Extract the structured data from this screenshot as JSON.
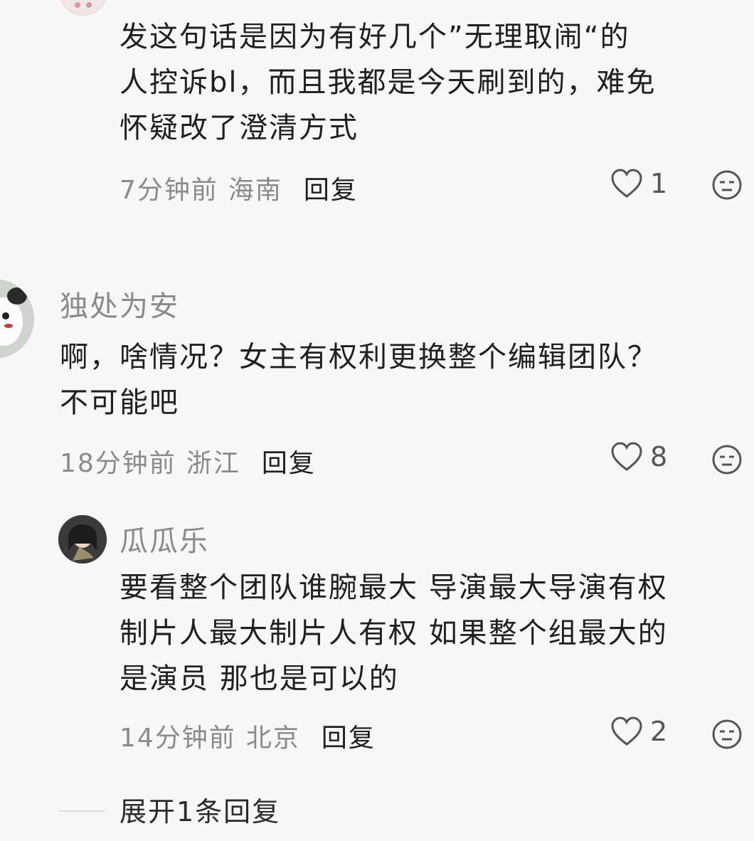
{
  "comments": [
    {
      "username": "",
      "content_lines": [
        "发这句话是因为有好几个”无理取闹“的",
        "人控诉bl，而且我都是今天刷到的，难免",
        "怀疑改了澄清方式"
      ],
      "time": "7分钟前",
      "location": "海南",
      "reply_label": "回复",
      "likes": "1"
    },
    {
      "username": "独处为安",
      "content_lines": [
        "啊，啥情况？女主有权利更换整个编辑团队？",
        "不可能吧"
      ],
      "time": "18分钟前",
      "location": "浙江",
      "reply_label": "回复",
      "likes": "8"
    },
    {
      "username": "瓜瓜乐",
      "content_lines": [
        "要看整个团队谁腕最大 导演最大导演有权",
        "制片人最大制片人有权 如果整个组最大的",
        "是演员 那也是可以的"
      ],
      "time": "14分钟前",
      "location": "北京",
      "reply_label": "回复",
      "likes": "2"
    }
  ],
  "expand_replies_label": "展开1条回复",
  "icons": {
    "like": "heart-outline-icon",
    "dislike": "neutral-face-icon"
  }
}
